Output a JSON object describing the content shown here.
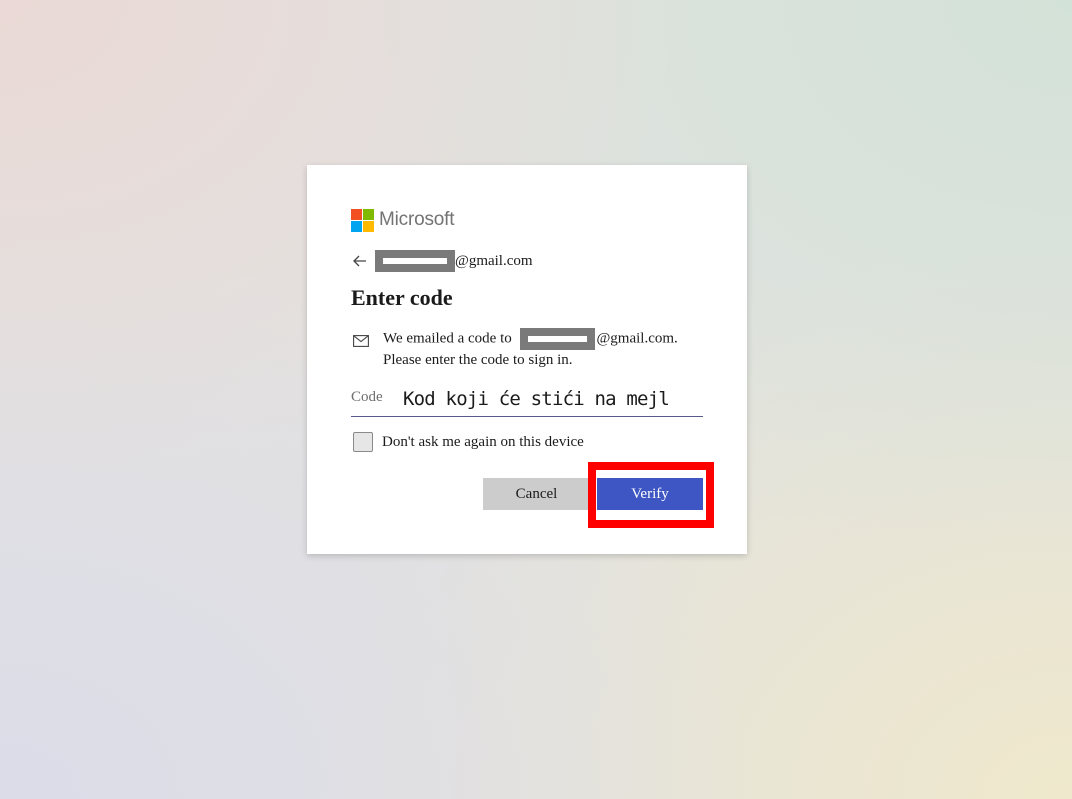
{
  "logo": {
    "text": "Microsoft",
    "colors": [
      "#f25022",
      "#7fba00",
      "#00a4ef",
      "#ffb900"
    ]
  },
  "identity": {
    "email_domain": "@gmail.com"
  },
  "title": "Enter code",
  "info": {
    "prefix": "We emailed a code to ",
    "suffix": "@gmail.com.",
    "line2": "Please enter the code to sign in."
  },
  "code": {
    "label": "Code",
    "value": "Kod koji će stići na mejl"
  },
  "remember": {
    "label": "Don't ask me again on this device",
    "checked": false
  },
  "buttons": {
    "cancel": "Cancel",
    "verify": "Verify"
  },
  "colors": {
    "primary": "#3e56c3",
    "secondary": "#cccccc",
    "highlight": "#ff0000"
  }
}
